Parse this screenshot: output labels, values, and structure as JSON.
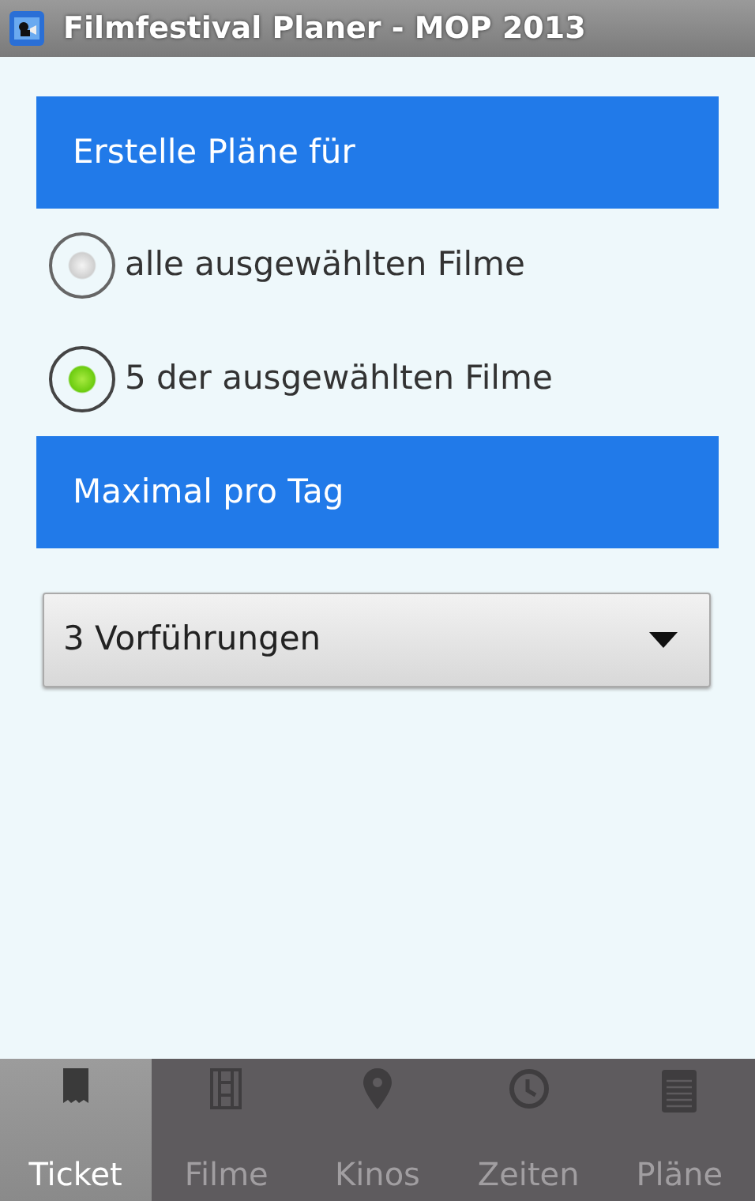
{
  "window": {
    "title": "Filmfestival Planer - MOP 2013"
  },
  "sections": [
    {
      "header": "Erstelle Pläne für",
      "options": [
        {
          "label": "alle ausgewählten Filme",
          "selected": false
        },
        {
          "label": "5 der ausgewählten Filme",
          "selected": true
        }
      ]
    },
    {
      "header": "Maximal pro Tag",
      "dropdown": {
        "value": "3 Vorführungen"
      }
    }
  ],
  "tabs": [
    {
      "label": "Ticket",
      "selected": true
    },
    {
      "label": "Filme",
      "selected": false
    },
    {
      "label": "Kinos",
      "selected": false
    },
    {
      "label": "Zeiten",
      "selected": false
    },
    {
      "label": "Pläne",
      "selected": false
    }
  ]
}
